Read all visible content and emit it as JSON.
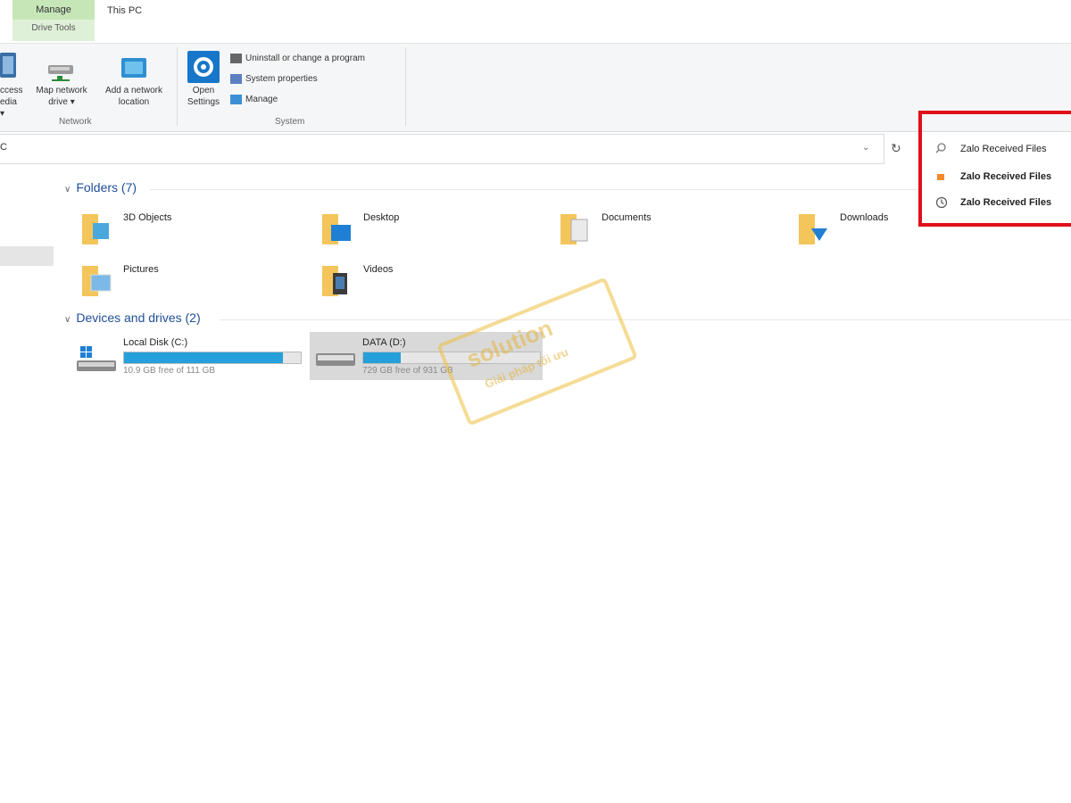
{
  "tabs": {
    "context_tab": "Manage",
    "context_group": "Drive Tools",
    "location_tab": "This PC"
  },
  "ribbon": {
    "network": {
      "access_media": "ccess\nedia ▾",
      "map_drive": "Map network\ndrive ▾",
      "add_location": "Add a network\nlocation",
      "label": "Network"
    },
    "system": {
      "open_settings": "Open\nSettings",
      "uninstall": "Uninstall or change a program",
      "properties": "System properties",
      "manage": "Manage",
      "label": "System"
    }
  },
  "address": {
    "path": "C",
    "chevron": "⌄",
    "refresh": "↻"
  },
  "search": {
    "value": "Zalo Received Files",
    "suggestions": [
      {
        "label": "Zalo Received Files",
        "icon": "folder-icon"
      },
      {
        "label": "Zalo Received Files",
        "icon": "history-icon"
      }
    ]
  },
  "folders": {
    "heading": "Folders (7)",
    "items": [
      {
        "name": "3D Objects"
      },
      {
        "name": "Desktop"
      },
      {
        "name": "Documents"
      },
      {
        "name": "Downloads"
      },
      {
        "name": "Pictures"
      },
      {
        "name": "Videos"
      }
    ]
  },
  "drives": {
    "heading": "Devices and drives (2)",
    "items": [
      {
        "name": "Local Disk (C:)",
        "free": "10.9 GB free of 111 GB",
        "used_fraction": 0.9
      },
      {
        "name": "DATA (D:)",
        "free": "729 GB free of 931 GB",
        "used_fraction": 0.21
      }
    ]
  },
  "watermark": {
    "line1": "solution",
    "line2": "Giải pháp tối ưu"
  },
  "colors": {
    "accent": "#26a0da",
    "highlight": "#e0101a",
    "heading": "#1f4e99",
    "folder": "#f4c55a"
  }
}
